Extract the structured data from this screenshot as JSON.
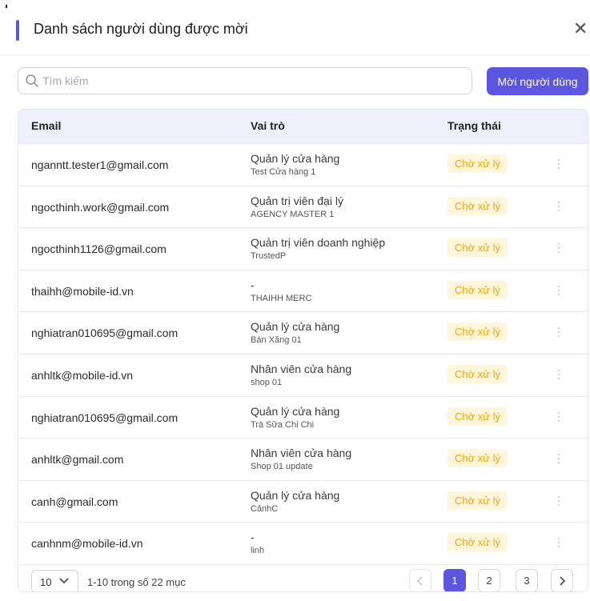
{
  "dialog": {
    "title": "Danh sách người dùng được mời",
    "close_icon": "close-icon",
    "accent_color": "#5b55e0"
  },
  "search": {
    "placeholder": "Tìm kiếm",
    "value": ""
  },
  "invite_button": {
    "label": "Mời người dùng"
  },
  "table": {
    "columns": [
      "Email",
      "Vai trò",
      "Trạng thái"
    ],
    "rows": [
      {
        "email": "nganntt.tester1@gmail.com",
        "role": "Quản lý cửa hàng",
        "sub": "Test Cửa hàng 1",
        "status": "Chờ xử lý"
      },
      {
        "email": "ngocthinh.work@gmail.com",
        "role": "Quản trị viên đại lý",
        "sub": "AGENCY MASTER 1",
        "status": "Chờ xử lý"
      },
      {
        "email": "ngocthinh1126@gmail.com",
        "role": "Quản trị viên doanh nghiệp",
        "sub": "TrustedP",
        "status": "Chờ xử lý"
      },
      {
        "email": "thaihh@mobile-id.vn",
        "role": "-",
        "sub": "THAIHH MERC",
        "status": "Chờ xử lý"
      },
      {
        "email": "nghiatran010695@gmail.com",
        "role": "Quản lý cửa hàng",
        "sub": "Bán Xăng 01",
        "status": "Chờ xử lý"
      },
      {
        "email": "anhltk@mobile-id.vn",
        "role": "Nhân viên cửa hàng",
        "sub": "shop 01",
        "status": "Chờ xử lý"
      },
      {
        "email": "nghiatran010695@gmail.com",
        "role": "Quản lý cửa hàng",
        "sub": "Trà Sữa Chi Chi",
        "status": "Chờ xử lý"
      },
      {
        "email": "anhltk@gmail.com",
        "role": "Nhân viên cửa hàng",
        "sub": "Shop 01 update",
        "status": "Chờ xử lý"
      },
      {
        "email": "canh@gmail.com",
        "role": "Quản lý cửa hàng",
        "sub": "CảnhC",
        "status": "Chờ xử lý"
      },
      {
        "email": "canhnm@mobile-id.vn",
        "role": "-",
        "sub": "linh",
        "status": "Chờ xử lý"
      }
    ],
    "status_colors": {
      "text": "#f0a500",
      "background": "#fff6dc"
    },
    "row_action_icon": "more-vertical-icon"
  },
  "pagination": {
    "page_size": "10",
    "range_text": "1-10 trong số 22 mục",
    "pages": [
      "1",
      "2",
      "3"
    ],
    "current_page": "1",
    "prev_icon": "chevron-left-icon",
    "next_icon": "chevron-right-icon"
  }
}
